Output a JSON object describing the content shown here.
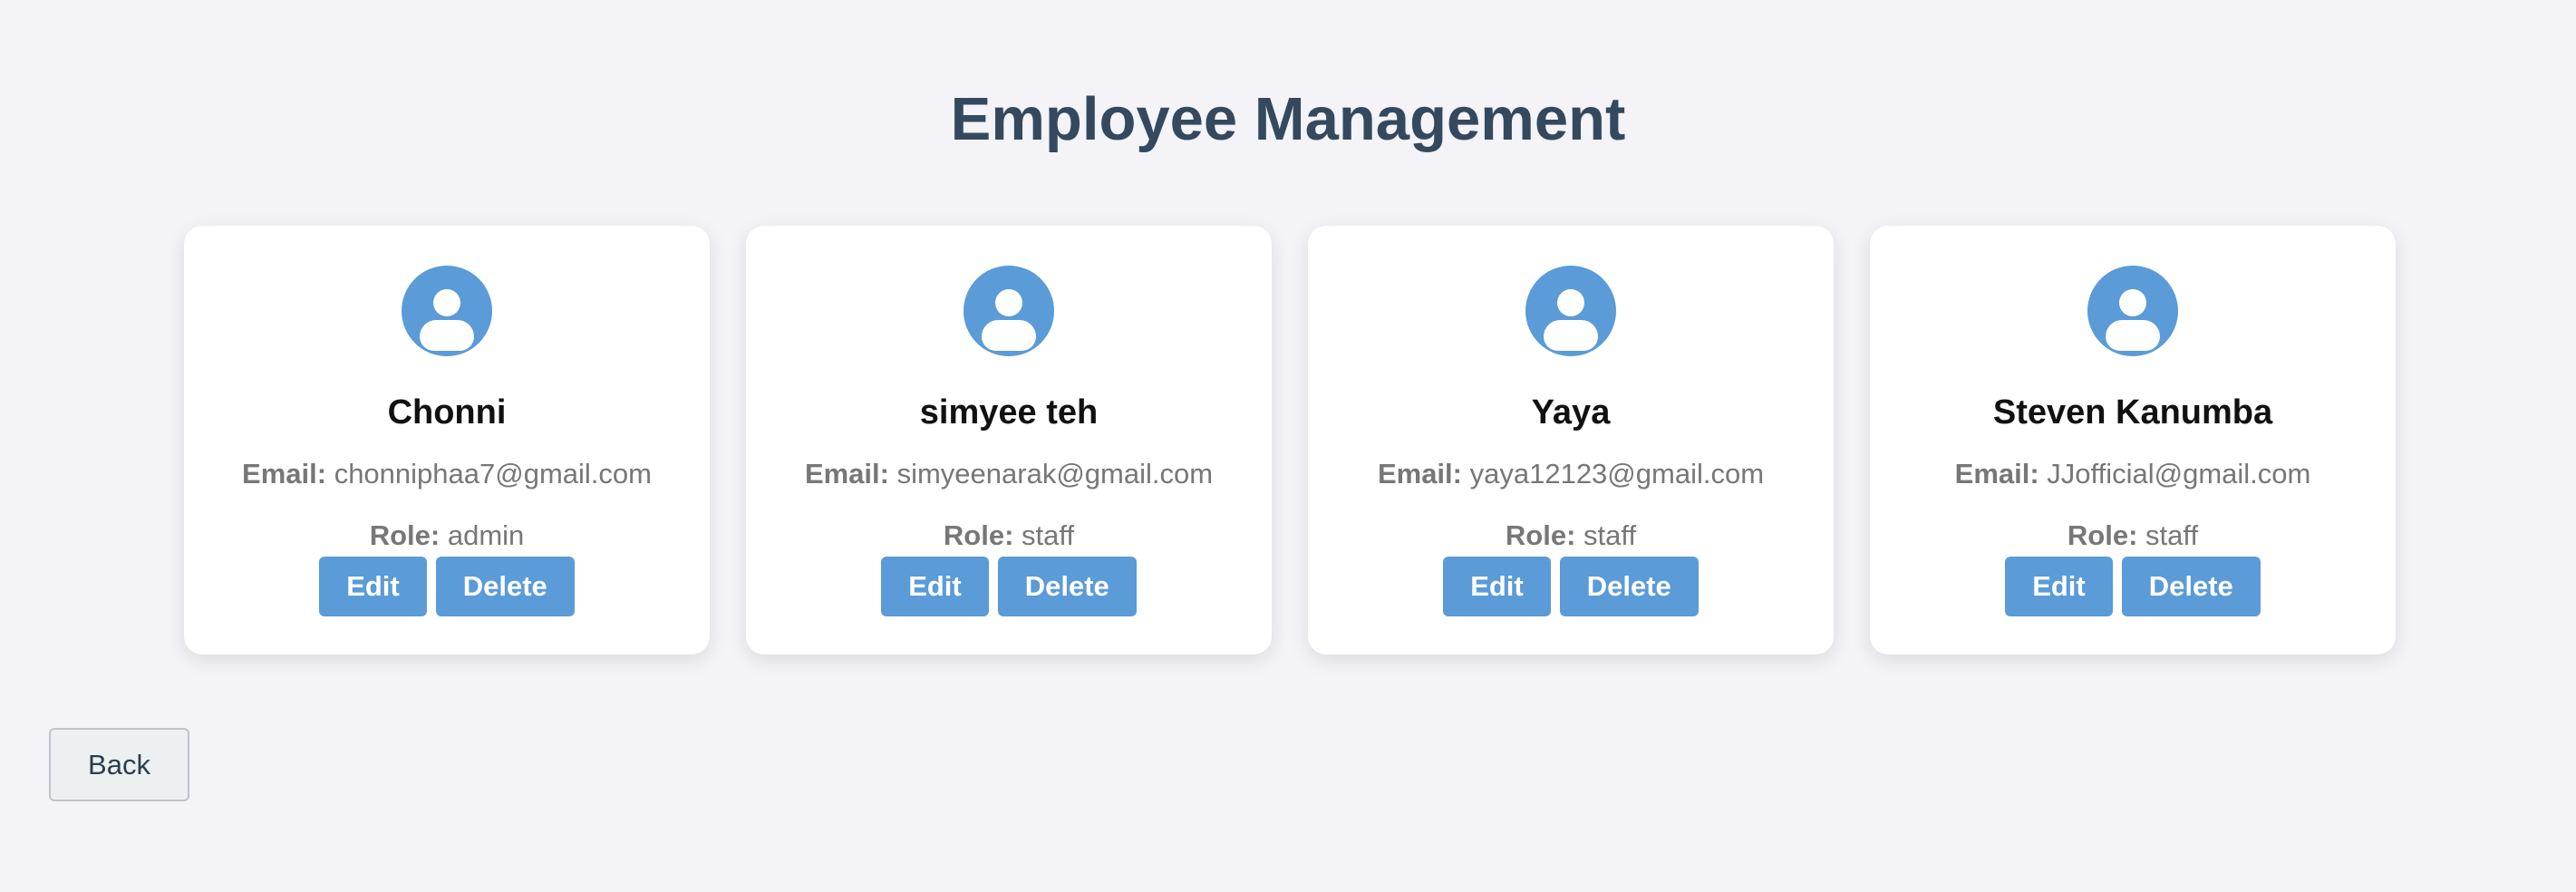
{
  "page": {
    "title": "Employee Management"
  },
  "labels": {
    "email": "Email:",
    "role": "Role:"
  },
  "employees": [
    {
      "name": "Chonni",
      "email": "chonniphaa7@gmail.com",
      "role": "admin",
      "edit_label": "Edit",
      "delete_label": "Delete"
    },
    {
      "name": "simyee teh",
      "email": "simyeenarak@gmail.com",
      "role": "staff",
      "edit_label": "Edit",
      "delete_label": "Delete"
    },
    {
      "name": "Yaya",
      "email": "yaya12123@gmail.com",
      "role": "staff",
      "edit_label": "Edit",
      "delete_label": "Delete"
    },
    {
      "name": "Steven Kanumba",
      "email": "JJofficial@gmail.com",
      "role": "staff",
      "edit_label": "Edit",
      "delete_label": "Delete"
    }
  ],
  "footer": {
    "back_label": "Back"
  },
  "icons": {
    "avatar": "user-avatar-icon"
  },
  "colors": {
    "accent": "#5a9bd8",
    "title": "#34495e",
    "background": "#f3f3f8"
  }
}
